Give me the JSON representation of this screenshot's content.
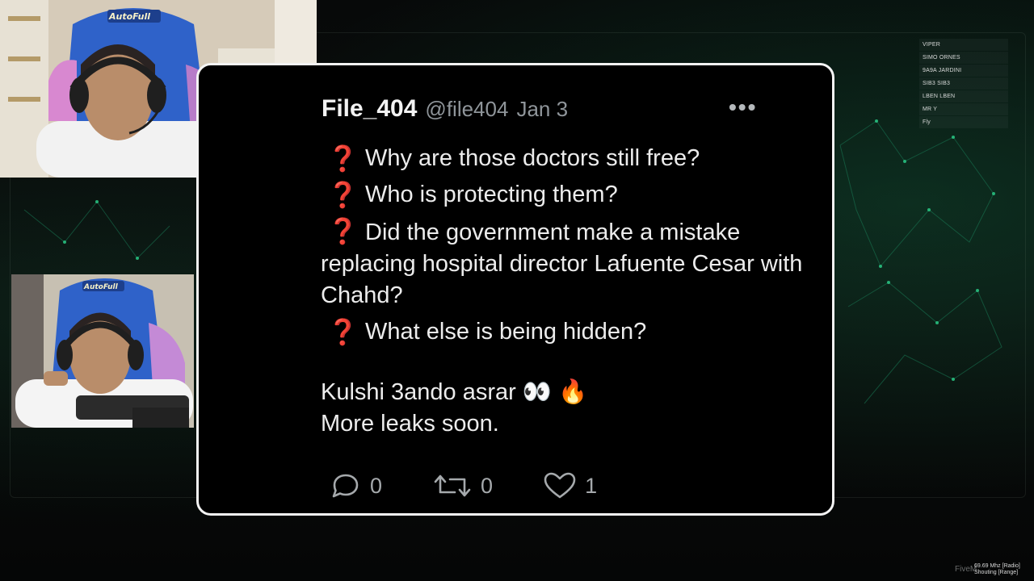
{
  "scoreboard": {
    "rows": [
      "VIPER",
      "SIMO ORNES",
      "9A9A JARDINI",
      "SIB3 SIB3",
      "LBEN LBEN",
      "MR Y",
      "Fly"
    ]
  },
  "tweet": {
    "display_name": "File_404",
    "handle": "@file404",
    "date": "Jan 3",
    "more_label": "•••",
    "question_mark": "❓",
    "questions": [
      "Why are those doctors still free?",
      "Who is protecting them?",
      "Did the government make a mistake replacing hospital director Lafuente Cesar with Chahd?",
      "What else is being hidden?"
    ],
    "closing_line_1": "Kulshi 3ando asrar 👀 🔥",
    "closing_line_2": "More leaks soon.",
    "replies": "0",
    "retweets": "0",
    "likes": "1"
  },
  "overlay": {
    "footer_tag": "FiveM",
    "radio_line_1": "69.69 Mhz [Radio]",
    "radio_line_2": "Shouting [Range]"
  },
  "colors": {
    "card_bg": "#000000",
    "card_border": "#f4f4f4",
    "text": "#ececec",
    "muted": "#8f959a",
    "question_red": "#e02b3a",
    "accent_green": "#1fa070"
  },
  "icons": [
    "reply-icon",
    "retweet-icon",
    "like-icon",
    "more-icon"
  ]
}
